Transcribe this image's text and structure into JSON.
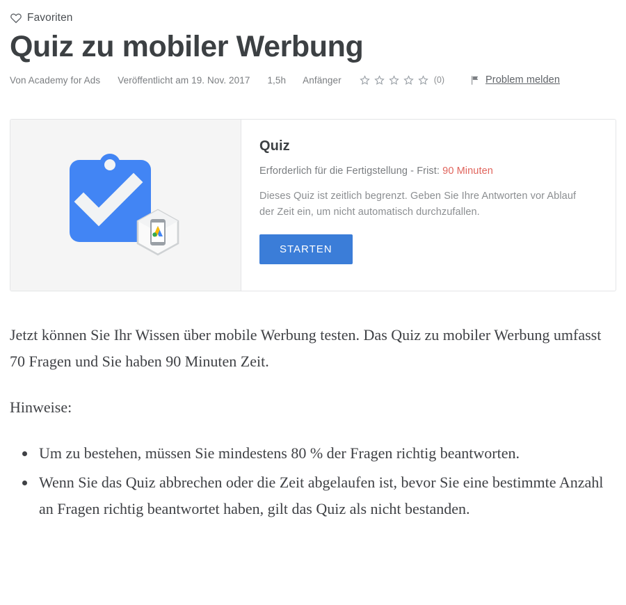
{
  "favorites": {
    "label": "Favoriten",
    "icon": "heart-icon"
  },
  "header": {
    "title": "Quiz zu mobiler Werbung"
  },
  "meta": {
    "author": "Von Academy for Ads",
    "published": "Veröffentlicht am 19. Nov. 2017",
    "duration": "1,5h",
    "level": "Anfänger",
    "rating_stars": 0,
    "rating_max": 5,
    "rating_count": "(0)",
    "report_label": "Problem melden",
    "report_icon": "flag-icon"
  },
  "card": {
    "title": "Quiz",
    "deadline_prefix": "Erforderlich für die Fertigstellung - Frist: ",
    "deadline_value": "90 Minuten",
    "description": "Dieses Quiz ist zeitlich begrenzt. Geben Sie Ihre Antworten vor Ablauf der Zeit ein, um nicht automatisch durchzufallen.",
    "start_label": "STARTEN",
    "art_icon": "quiz-clipboard-check-icon",
    "badge_icon": "google-ads-mobile-hexagon-icon"
  },
  "content": {
    "intro": "Jetzt können Sie Ihr Wissen über mobile Werbung testen. Das Quiz zu mobiler Werbung umfasst 70 Fragen und Sie haben 90 Minuten Zeit.",
    "notes_heading": "Hinweise:",
    "notes": [
      "Um zu bestehen, müssen Sie mindestens 80 % der Fragen richtig beantworten.",
      "Wenn Sie das Quiz abbrechen oder die Zeit abgelaufen ist, bevor Sie eine bestimmte Anzahl an Fragen richtig beantwortet haben, gilt das Quiz als nicht bestanden."
    ]
  },
  "colors": {
    "accent_blue": "#3b7dd8",
    "deadline_red": "#e0645c",
    "title_gray": "#3c4043",
    "meta_gray": "#7a7d80",
    "panel_gray": "#f5f5f5"
  }
}
